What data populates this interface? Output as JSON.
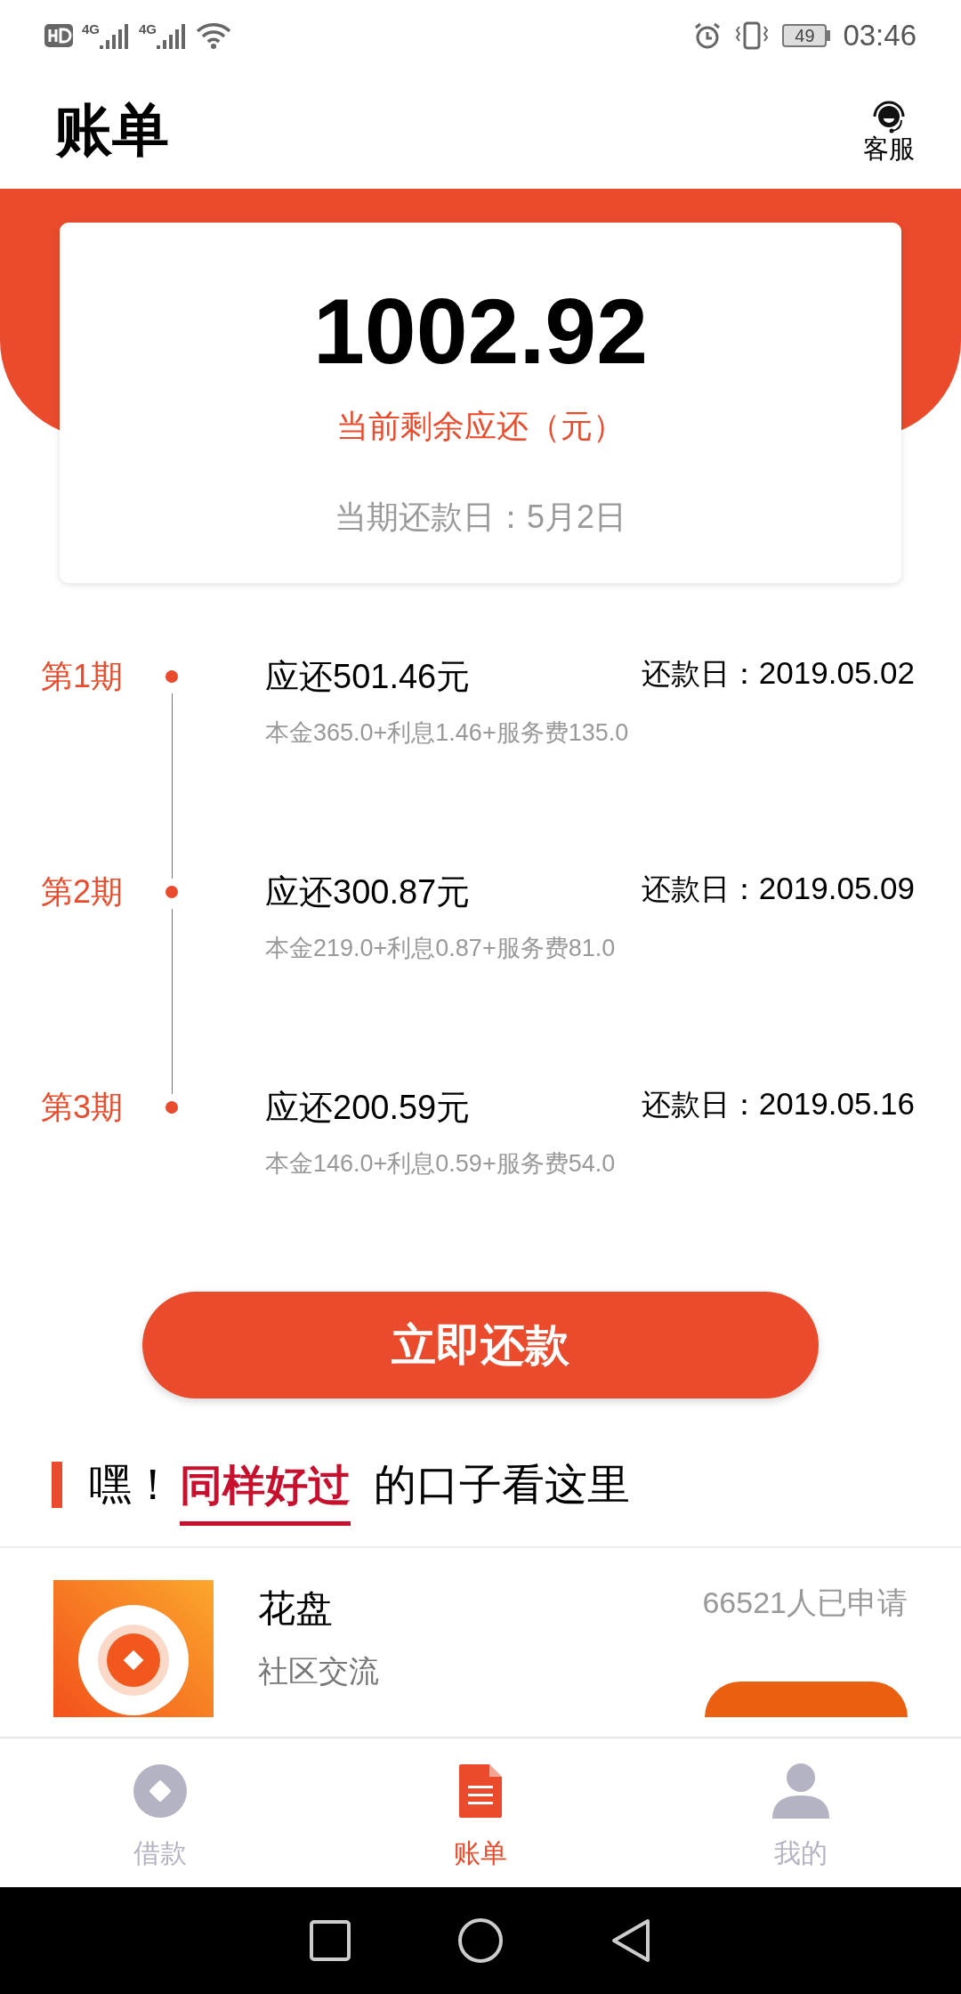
{
  "status_bar": {
    "time": "03:46",
    "battery": "49",
    "network_1": "4G",
    "network_2": "4G"
  },
  "header": {
    "title": "账单",
    "service_label": "客服"
  },
  "summary": {
    "amount": "1002.92",
    "amount_label": "当前剩余应还（元）",
    "due_date": "当期还款日：5月2日"
  },
  "installments": [
    {
      "period": "第1期",
      "amount": "应还501.46元",
      "date_label": "还款日：",
      "date": "2019.05.02",
      "breakdown": "本金365.0+利息1.46+服务费135.0"
    },
    {
      "period": "第2期",
      "amount": "应还300.87元",
      "date_label": "还款日：",
      "date": "2019.05.09",
      "breakdown": "本金219.0+利息0.87+服务费81.0"
    },
    {
      "period": "第3期",
      "amount": "应还200.59元",
      "date_label": "还款日：",
      "date": "2019.05.16",
      "breakdown": "本金146.0+利息0.59+服务费54.0"
    }
  ],
  "repay_button": "立即还款",
  "promo_heading": {
    "prefix": "嘿！",
    "highlight": "同样好过",
    "suffix": "的口子看这里"
  },
  "products": [
    {
      "name": "花盘",
      "tag": "社区交流",
      "applicants": "66521人已申请"
    }
  ],
  "tab_bar": [
    {
      "label": "借款",
      "kind": "loan",
      "selected": false
    },
    {
      "label": "账单",
      "kind": "bill",
      "selected": true
    },
    {
      "label": "我的",
      "kind": "profile",
      "selected": false
    }
  ]
}
